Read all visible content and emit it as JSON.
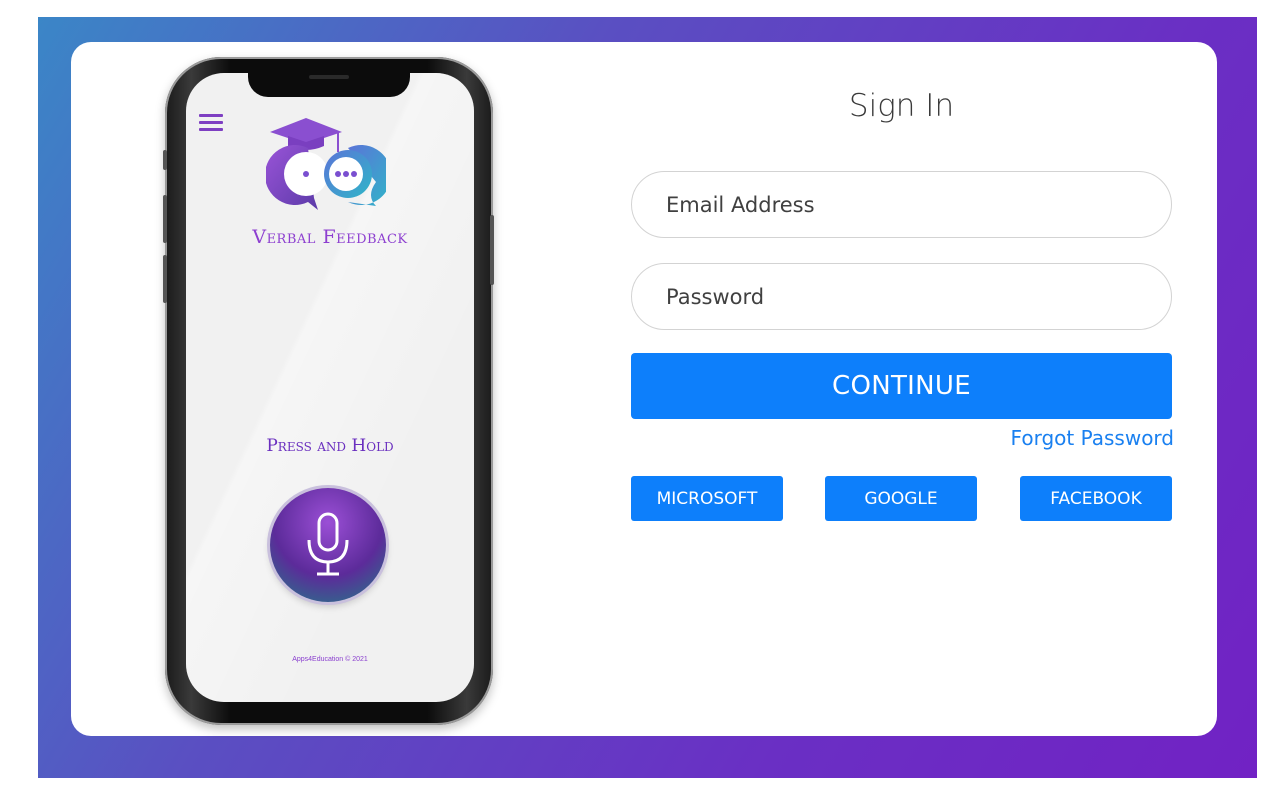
{
  "phone": {
    "brand_name": "Verbal Feedback",
    "press_label": "Press and Hold",
    "copyright": "Apps4Education © 2021",
    "icons": {
      "menu": "hamburger-menu-icon",
      "logo": "graduation-chat-bubbles-logo",
      "mic": "microphone-icon"
    },
    "colors": {
      "brand": "#8d3fd0",
      "accent": "#6a2fbf"
    }
  },
  "form": {
    "title": "Sign In",
    "email_placeholder": "Email Address",
    "email_value": "",
    "password_placeholder": "Password",
    "password_value": "",
    "continue_label": "CONTINUE",
    "forgot_label": "Forgot Password",
    "social": [
      "MICROSOFT",
      "GOOGLE",
      "FACEBOOK"
    ],
    "colors": {
      "button": "#0d7ffb",
      "link": "#1a80f0"
    }
  },
  "theme": {
    "gradient_start": "#3b86c7",
    "gradient_end": "#7122c4"
  }
}
